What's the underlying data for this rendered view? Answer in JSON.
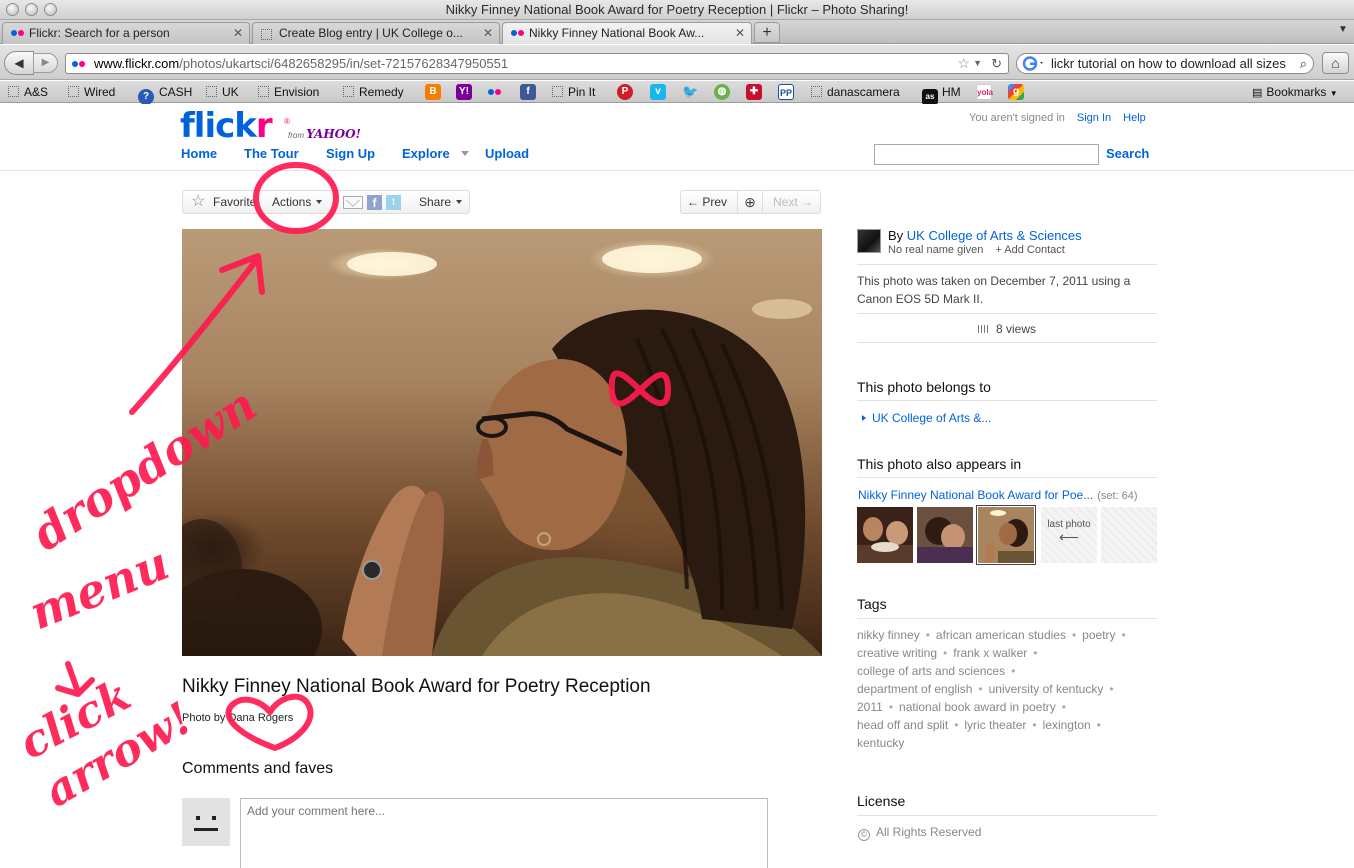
{
  "window": {
    "title": "Nikky Finney National Book Award for Poetry Reception | Flickr – Photo Sharing!"
  },
  "tabs": [
    {
      "label": "Flickr: Search for a person",
      "favicon": "flickr-icon"
    },
    {
      "label": "Create Blog entry | UK College o...",
      "favicon": "page-icon"
    },
    {
      "label": "Nikky Finney National Book Aw...",
      "favicon": "flickr-icon"
    }
  ],
  "address_bar": {
    "host": "www.flickr.com",
    "path": "/photos/ukartsci/6482658295/in/set-72157628347950551"
  },
  "search_bar": {
    "value": "lickr tutorial on how to download all sizes"
  },
  "bookmarks": {
    "items": [
      {
        "label": "A&S"
      },
      {
        "label": "Wired"
      },
      {
        "label": "CASH"
      },
      {
        "label": "UK"
      },
      {
        "label": "Envision"
      },
      {
        "label": "Remedy"
      },
      {
        "label": "Pin It"
      },
      {
        "label": "danascamera"
      },
      {
        "label": "HM"
      }
    ],
    "menu_label": "Bookmarks"
  },
  "flickr": {
    "logo_text_1": "flick",
    "logo_text_2": "r",
    "from_label": "from",
    "yahoo_label": "YAHOO!",
    "signin_status": "You aren't signed in",
    "sign_in_link": "Sign In",
    "help_link": "Help",
    "nav": {
      "home": "Home",
      "tour": "The Tour",
      "signup": "Sign Up",
      "explore": "Explore",
      "upload": "Upload"
    },
    "search_button": "Search"
  },
  "toolbar": {
    "favorite": "Favorite",
    "actions": "Actions",
    "share": "Share",
    "prev": "← Prev",
    "next": "Next →"
  },
  "photo": {
    "title": "Nikky Finney National Book Award for Poetry Reception",
    "by_label": "Photo by",
    "photographer": "Dana Rogers"
  },
  "comments": {
    "heading": "Comments and faves",
    "placeholder": "Add your comment here..."
  },
  "sidebar": {
    "by_label": "By",
    "owner": "UK College of Arts & Sciences",
    "no_real_name": "No real name given",
    "add_contact": "+ Add Contact",
    "taken_text": "This photo was taken on December 7, 2011 using a Canon EOS 5D Mark II.",
    "views": "8 views",
    "belongs_heading": "This photo belongs to",
    "belongs_link": "UK College of Arts &...",
    "appears_heading": "This photo also appears in",
    "set_link": "Nikky Finney National Book Award for Poe...",
    "set_count": "(set: 64)",
    "last_photo": "last photo",
    "last_photo_arrow": "⟵",
    "tags_heading": "Tags",
    "tags": [
      "nikky finney",
      "african american studies",
      "poetry",
      "creative writing",
      "frank x walker",
      "college of arts and sciences",
      "department of english",
      "university of kentucky",
      "2011",
      "national book award in poetry",
      "head off and split",
      "lyric theater",
      "lexington",
      "kentucky"
    ],
    "license_heading": "License",
    "license": "All Rights Reserved"
  },
  "annotation": {
    "color": "#ff1a4f",
    "line1": "dropdown",
    "line2": "menu",
    "line3": "click",
    "line4": "arrow!"
  }
}
